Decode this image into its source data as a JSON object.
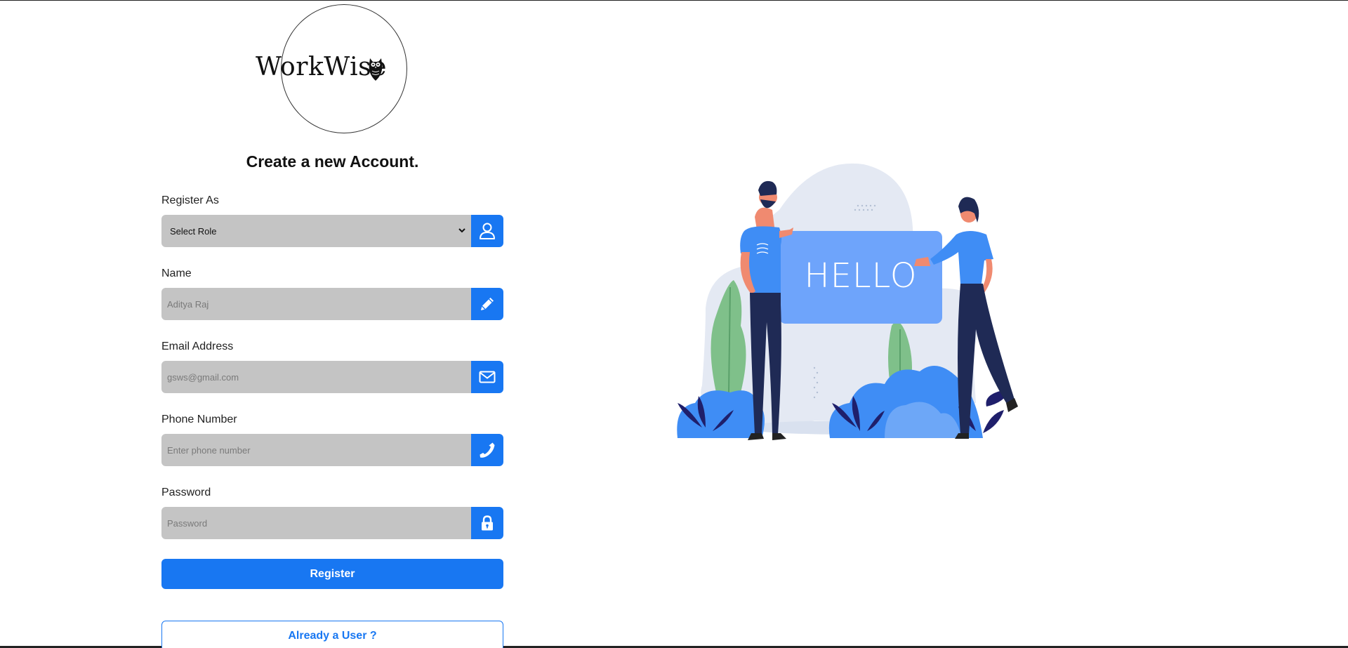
{
  "brand": {
    "name": "WorkWise"
  },
  "form": {
    "title": "Create a new Account.",
    "fields": {
      "role": {
        "label": "Register As",
        "value": "Select Role"
      },
      "name": {
        "label": "Name",
        "placeholder": "Aditya Raj"
      },
      "email": {
        "label": "Email Address",
        "placeholder": "gsws@gmail.com"
      },
      "phone": {
        "label": "Phone Number",
        "placeholder": "Enter phone number"
      },
      "password": {
        "label": "Password",
        "placeholder": "Password"
      }
    },
    "register_label": "Register",
    "login_label": "Already a User ?"
  },
  "illustration": {
    "sign_text": "HELLO"
  },
  "colors": {
    "accent": "#1877f2",
    "field_bg": "#c4c4c4",
    "sign": "#6ea4fb"
  },
  "icons": [
    "user-icon",
    "pencil-icon",
    "envelope-icon",
    "phone-icon",
    "lock-icon",
    "owl-icon",
    "chevron-down-icon"
  ]
}
